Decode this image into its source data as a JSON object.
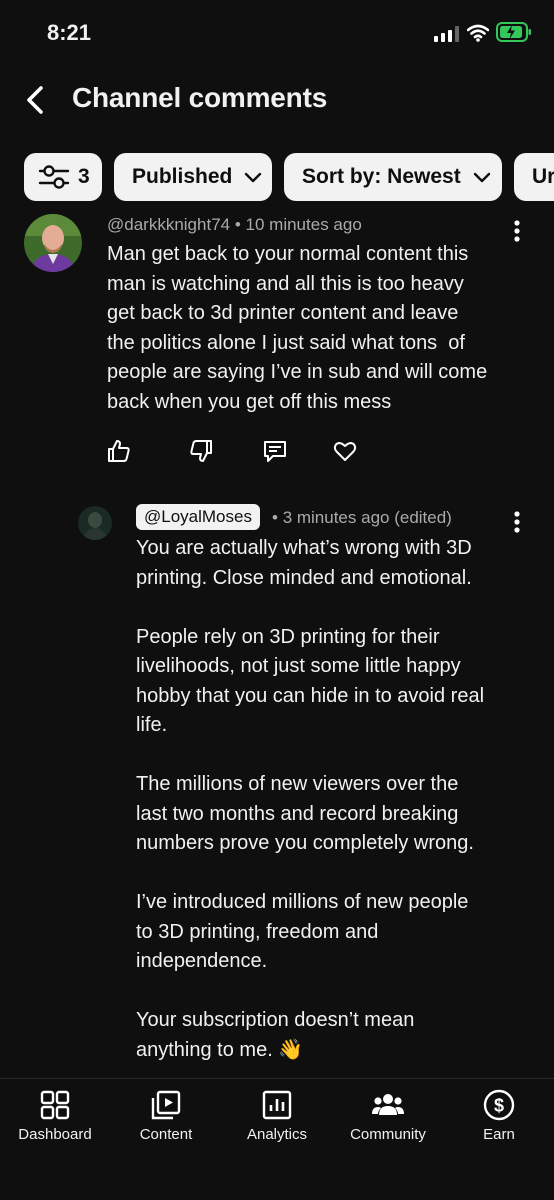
{
  "status": {
    "time": "8:21"
  },
  "header": {
    "title": "Channel comments"
  },
  "filters": {
    "filter_count": "3",
    "published": "Published",
    "sort": "Sort by: Newest",
    "partial": "Ur"
  },
  "comment": {
    "author": "@darkkknight74",
    "age": "10 minutes ago",
    "text": "Man get back to your normal content this\nman is watching and all this is too heavy\nget back to 3d printer content and leave\nthe politics alone I just said what tons  of\npeople are saying I’ve in sub and will come\nback when you get off this mess"
  },
  "reply": {
    "author": "@LoyalMoses",
    "age": "3 minutes ago (edited)",
    "text": "You are actually what’s wrong with 3D\nprinting. Close minded and emotional.\n\nPeople rely on 3D printing for their\nlivelihoods, not just some little happy\nhobby that you can hide in to avoid real\nlife.\n\nThe millions of new viewers over the\nlast two months and record breaking\nnumbers prove you completely wrong.\n\nI’ve introduced millions of new people\nto 3D printing, freedom and\nindependence.\n\nYour subscription doesn’t mean\nanything to me. 👋"
  },
  "nav": {
    "dashboard": "Dashboard",
    "content": "Content",
    "analytics": "Analytics",
    "community": "Community",
    "earn": "Earn"
  },
  "colors": {
    "background": "#0f0f0f",
    "chip": "#f2f2f2",
    "battery": "#34c759"
  },
  "icons": [
    "back-arrow",
    "filter-sliders",
    "chevron-down",
    "more-vert",
    "thumb-up",
    "thumb-down",
    "reply",
    "heart",
    "dashboard",
    "content",
    "analytics",
    "community",
    "earn-dollar"
  ]
}
